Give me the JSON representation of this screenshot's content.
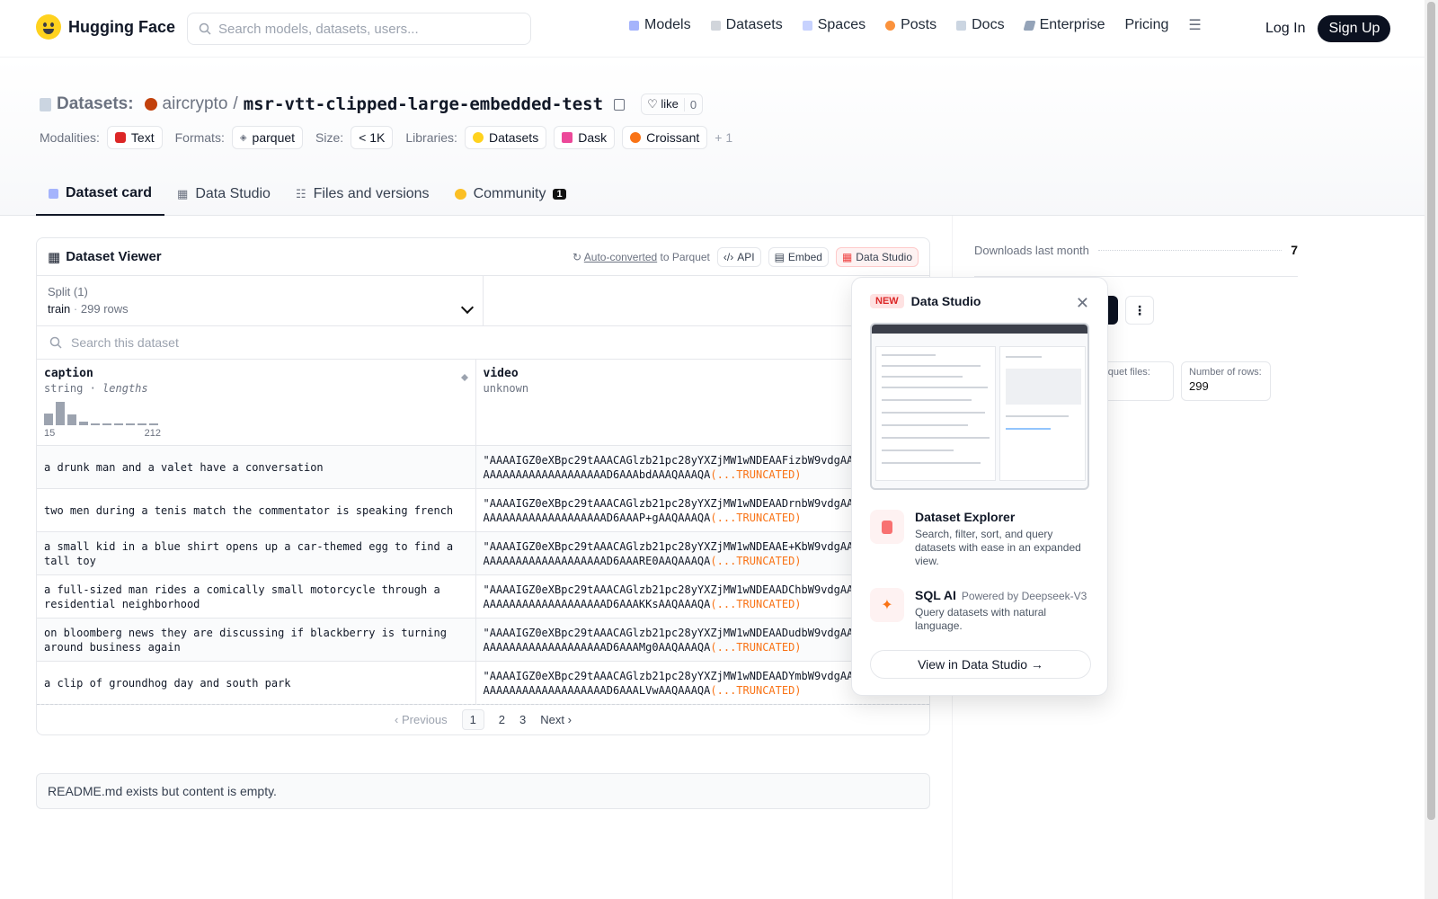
{
  "nav": {
    "brand": "Hugging Face",
    "search_placeholder": "Search models, datasets, users...",
    "links": [
      "Models",
      "Datasets",
      "Spaces",
      "Posts",
      "Docs",
      "Enterprise",
      "Pricing"
    ],
    "login": "Log In",
    "signup": "Sign Up"
  },
  "header": {
    "section": "Datasets:",
    "owner": "aircrypto",
    "separator": "/",
    "repo": "msr-vtt-clipped-large-embedded-test",
    "like_label": "like",
    "like_count": "0",
    "modalities_label": "Modalities:",
    "modality": "Text",
    "formats_label": "Formats:",
    "format": "parquet",
    "size_label": "Size:",
    "size": "< 1K",
    "libraries_label": "Libraries:",
    "libraries": [
      "Datasets",
      "Dask",
      "Croissant"
    ],
    "more_libraries": "+ 1"
  },
  "tabs": [
    {
      "label": "Dataset card",
      "active": true
    },
    {
      "label": "Data Studio"
    },
    {
      "label": "Files and versions"
    },
    {
      "label": "Community",
      "badge": "1"
    }
  ],
  "viewer": {
    "title": "Dataset Viewer",
    "auto_converted": "Auto-converted",
    "to_parquet": "to Parquet",
    "api": "API",
    "embed": "Embed",
    "data_studio": "Data Studio",
    "split_label": "Split (1)",
    "split_name": "train",
    "split_rows": "299 rows",
    "search_placeholder": "Search this dataset",
    "columns": [
      {
        "name": "caption",
        "type": "string",
        "extra": "lengths",
        "min": "15",
        "max": "212"
      },
      {
        "name": "video",
        "type": "unknown"
      }
    ],
    "histogram": [
      0.5,
      1.0,
      0.45,
      0.15,
      0.05,
      0.05,
      0.05,
      0.05,
      0.05,
      0.05
    ],
    "rows": [
      {
        "caption": "a drunk man and a valet have a conversation",
        "v1": "\"AAAAIGZ0eXBpc29tAAACAGlzb21pc28yYXZjMW1wNDEAAFizbW9vdgAAA",
        "v2": "AAAAAAAAAAAAAAAAAAAD6AAAbdAAAQAAAQA"
      },
      {
        "caption": "two men during a tenis match the commentator is speaking french",
        "v1": "\"AAAAIGZ0eXBpc29tAAACAGlzb21pc28yYXZjMW1wNDEAADrnbW9vdgAAA",
        "v2": "AAAAAAAAAAAAAAAAAAAD6AAAP+gAAQAAAQA"
      },
      {
        "caption": "a small kid in a blue shirt opens up a car-themed egg to find a tall toy",
        "v1": "\"AAAAIGZ0eXBpc29tAAACAGlzb21pc28yYXZjMW1wNDEAAE+KbW9vdgAAA",
        "v2": "AAAAAAAAAAAAAAAAAAAD6AAARE0AAQAAAQA"
      },
      {
        "caption": "a full-sized man rides a comically small motorcycle through a residential neighborhood",
        "v1": "\"AAAAIGZ0eXBpc29tAAACAGlzb21pc28yYXZjMW1wNDEAADChbW9vdgAAA",
        "v2": "AAAAAAAAAAAAAAAAAAAD6AAAKKsAAQAAAQA"
      },
      {
        "caption": "on bloomberg news they are discussing if blackberry is turning around business again",
        "v1": "\"AAAAIGZ0eXBpc29tAAACAGlzb21pc28yYXZjMW1wNDEAADudbW9vdgAAA",
        "v2": "AAAAAAAAAAAAAAAAAAAD6AAAMg0AAQAAAQA"
      },
      {
        "caption": "a clip of groundhog day and south park",
        "v1": "\"AAAAIGZ0eXBpc29tAAACAGlzb21pc28yYXZjMW1wNDEAADYmbW9vdgAAA",
        "v2": "AAAAAAAAAAAAAAAAAAAD6AAALVwAAQAAAQA"
      }
    ],
    "truncated": "(...TRUNCATED)",
    "pager": {
      "previous": "Previous",
      "pages": [
        "1",
        "2",
        "3"
      ],
      "next": "Next"
    }
  },
  "readme": "README.md exists but content is empty.",
  "sidebar": {
    "downloads_label": "Downloads last month",
    "downloads_value": "7",
    "parquet_label": "arquet files:",
    "rows_label": "Number of rows:",
    "rows_value": "299"
  },
  "popover": {
    "new": "NEW",
    "title": "Data Studio",
    "explorer_title": "Dataset Explorer",
    "explorer_desc": "Search, filter, sort, and query datasets with ease in an expanded view.",
    "sql_title": "SQL AI",
    "sql_sub": "Powered by Deepseek-V3",
    "sql_desc": "Query datasets with natural language.",
    "cta": "View in Data Studio →"
  },
  "colors": {
    "accent_red": "#ef4444",
    "dark": "#0b1120",
    "truncated": "#f97316"
  }
}
